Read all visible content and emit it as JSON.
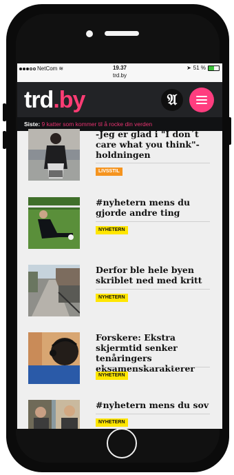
{
  "status_bar": {
    "carrier": "NetCom",
    "time": "19.37",
    "battery_percent": "51 %"
  },
  "url": "trd.by",
  "header": {
    "logo_main": "trd",
    "logo_suffix": ".by",
    "adresse_icon": "𝔄",
    "menu_icon": "hamburger-menu-icon"
  },
  "ticker": {
    "label": "Siste:",
    "text": "9 katter som kommer til å rocke din verden"
  },
  "articles": [
    {
      "headline": "-Jeg er glad i \"I don´t care what you think\"-holdningen",
      "tag": "LIVSSTIL"
    },
    {
      "headline": "#nyhetern mens du gjorde andre ting",
      "tag": "NYHETERN"
    },
    {
      "headline": "Derfor ble hele byen skriblet ned med kritt",
      "tag": "NYHETERN"
    },
    {
      "headline": "Forskere: Ekstra skjermtid senker tenåringers eksamenskarakterer",
      "tag": "NYHETERN"
    },
    {
      "headline": "#nyhetern mens du sov",
      "tag": "NYHETERN"
    }
  ],
  "colors": {
    "brand_pink": "#ff3c74",
    "tag_livsstil": "#f5941f",
    "tag_nyhetern": "#ffe600",
    "header_bg": "#222326"
  }
}
